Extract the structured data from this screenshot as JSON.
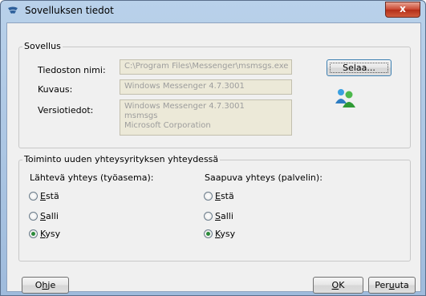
{
  "window": {
    "title": "Sovelluksen tiedot",
    "close_label": "x"
  },
  "app_group": {
    "legend": "Sovellus",
    "filename_label": "Tiedoston nimi:",
    "filename_value": "C:\\Program Files\\Messenger\\msmsgs.exe",
    "description_label": "Kuvaus:",
    "description_value": "Windows Messenger 4.7.3001",
    "version_label": "Versiotiedot:",
    "version_lines": [
      "Windows Messenger 4.7.3001",
      "msmsgs",
      "Microsoft Corporation"
    ],
    "browse_button": "Selaa...",
    "app_icon": "messenger-buddies-icon"
  },
  "action_group": {
    "legend": "Toiminto uuden yhteysyrityksen yhteydessä",
    "outgoing": {
      "heading": "Lähtevä yhteys (työasema):",
      "options": [
        {
          "first": "E",
          "rest": "stä",
          "checked": false
        },
        {
          "first": "S",
          "rest": "alli",
          "checked": false
        },
        {
          "first": "K",
          "rest": "ysy",
          "checked": true
        }
      ]
    },
    "incoming": {
      "heading": "Saapuva yhteys (palvelin):",
      "options": [
        {
          "first": "E",
          "rest": "stä",
          "checked": false
        },
        {
          "first": "S",
          "rest": "alli",
          "checked": false
        },
        {
          "first": "K",
          "rest": "ysy",
          "checked": true
        }
      ]
    }
  },
  "buttons": {
    "help_pre": "O",
    "help_u": "h",
    "help_post": "je",
    "ok_u": "O",
    "ok_post": "K",
    "cancel_pre": "Per",
    "cancel_u": "u",
    "cancel_post": "uta"
  }
}
